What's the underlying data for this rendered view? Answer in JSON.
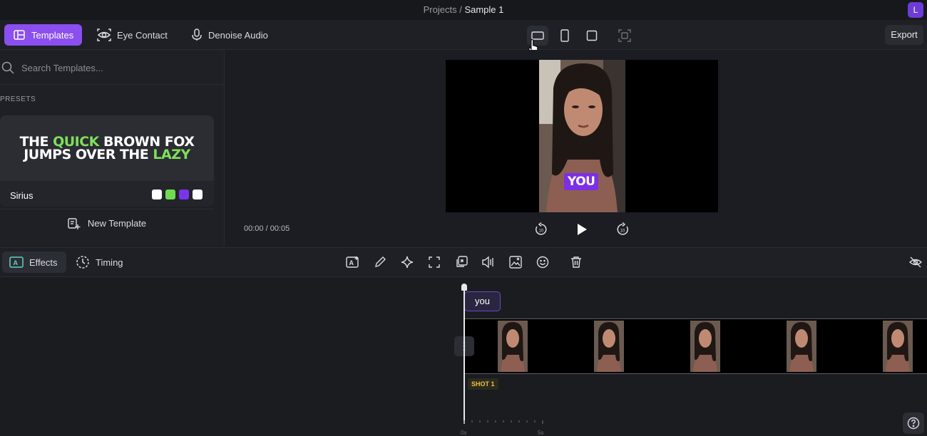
{
  "breadcrumb": {
    "parent": "Projects",
    "separator": "/",
    "current": "Sample 1"
  },
  "user": {
    "avatar_initial": "L",
    "avatar_color": "#6d3bd8"
  },
  "toolbar": {
    "templates_label": "Templates",
    "eye_contact_label": "Eye Contact",
    "denoise_label": "Denoise Audio",
    "export_label": "Export",
    "aspect_ratios": [
      "landscape-icon",
      "portrait-icon",
      "square-icon",
      "crop-icon"
    ],
    "selected_ratio": "landscape"
  },
  "templates_panel": {
    "search_placeholder": "Search Templates...",
    "presets_heading": "PRESETS",
    "preset": {
      "preview_line1": [
        "THE ",
        "QUICK",
        " BROWN FOX"
      ],
      "preview_line2": [
        "JUMPS OVER THE ",
        "LAZY"
      ],
      "name": "Sirius",
      "swatches": [
        "#ffffff",
        "#6fdc4f",
        "#7a35e8",
        "#ffffff"
      ]
    },
    "new_template_label": "New Template"
  },
  "preview": {
    "caption_word": "YOU",
    "time_current": "00:00",
    "time_total": "00:05",
    "time_display": "00:00 / 00:05"
  },
  "effects_bar": {
    "effects_label": "Effects",
    "timing_label": "Timing",
    "tools": [
      "add-text-icon",
      "pen-icon",
      "sparkle-icon",
      "expand-icon",
      "transition-icon",
      "audio-icon",
      "image-edit-icon",
      "emoji-icon",
      "trash-icon"
    ]
  },
  "timeline": {
    "caption_chip": "you",
    "shot_label": "SHOT 1",
    "ruler_start": "0s",
    "ruler_end": "5s"
  },
  "colors": {
    "accent": "#8b4ff0",
    "caption_bg": "#7c2fe6",
    "shot_badge": "#f0c23a"
  }
}
